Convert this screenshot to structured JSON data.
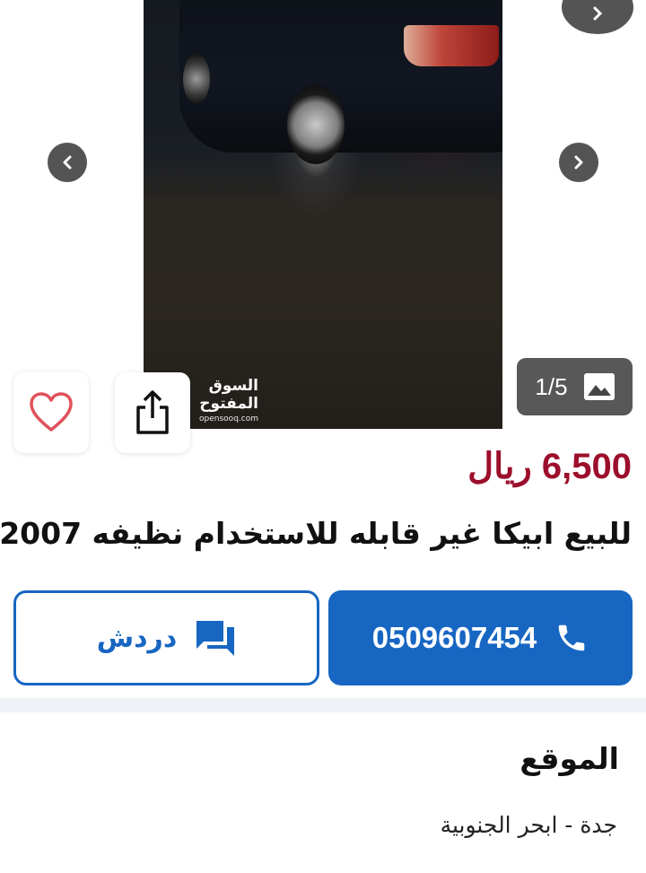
{
  "gallery": {
    "counter": "1/5",
    "watermark_ar": "السوق المفتوح",
    "watermark_en": "opensooq.com"
  },
  "listing": {
    "price": "6,500 ريال",
    "title": "للبيع ابيكا غير قابله للاستخدام نظيفه 2007"
  },
  "actions": {
    "phone_number": "0509607454",
    "chat_label": "دردش"
  },
  "location": {
    "heading": "الموقع",
    "value": "جدة - ابحر الجنوبية"
  },
  "colors": {
    "price": "#9c0f2c",
    "primary": "#1766c2",
    "favorite": "#e0525a"
  },
  "icons": [
    "chevron-left-icon",
    "chevron-right-icon",
    "image-icon",
    "heart-icon",
    "share-icon",
    "phone-icon",
    "chat-icon"
  ]
}
